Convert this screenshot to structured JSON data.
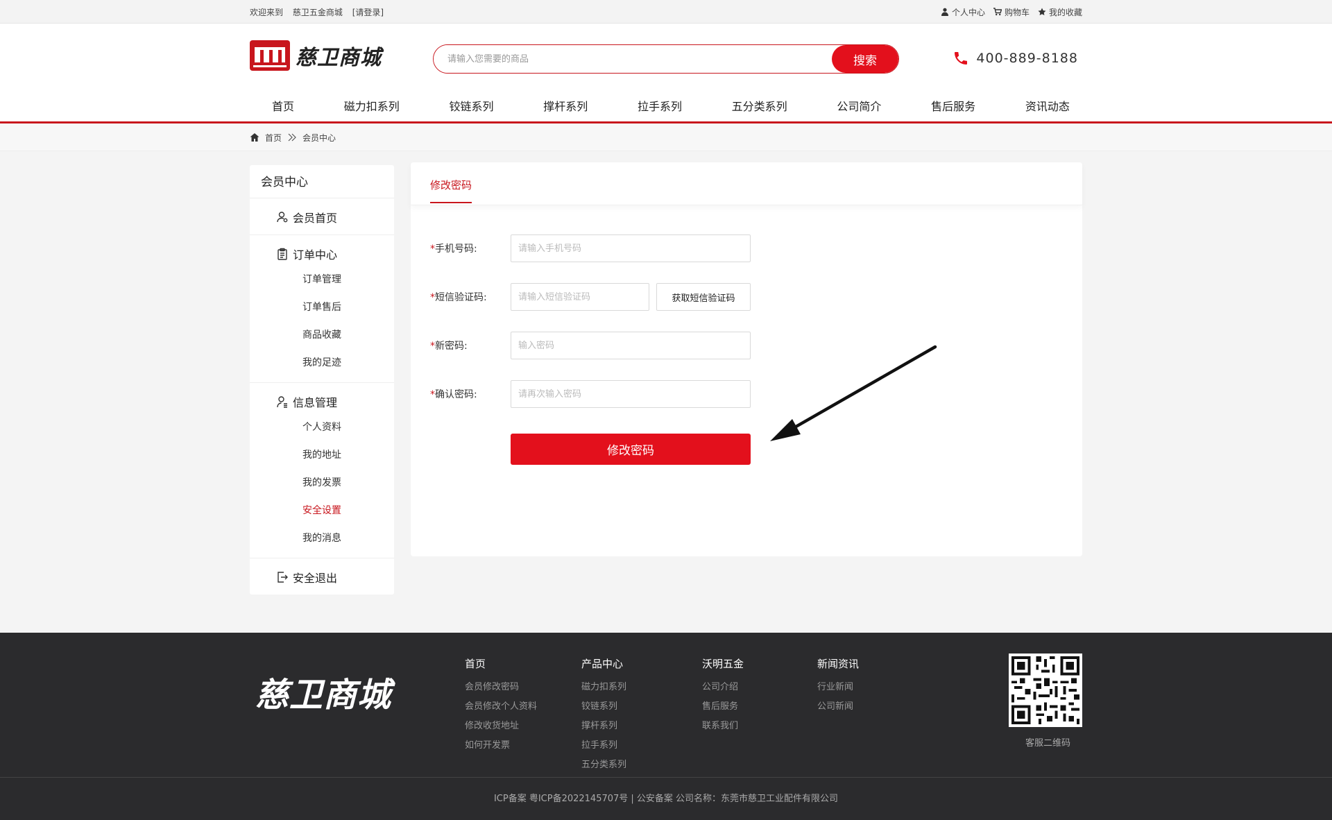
{
  "topbar": {
    "welcome": "欢迎来到",
    "site_name": "慈卫五金商城",
    "login": "[请登录]",
    "links": [
      {
        "icon": "user-icon",
        "label": "个人中心"
      },
      {
        "icon": "cart-icon",
        "label": "购物车"
      },
      {
        "icon": "star-icon",
        "label": "我的收藏"
      }
    ]
  },
  "header": {
    "logo_text": "慈卫商城",
    "search_placeholder": "请输入您需要的商品",
    "search_button": "搜索",
    "phone": "400-889-8188",
    "nav": [
      "首页",
      "磁力扣系列",
      "铰链系列",
      "撑杆系列",
      "拉手系列",
      "五分类系列",
      "公司简介",
      "售后服务",
      "资讯动态"
    ]
  },
  "breadcrumb": {
    "home": "首页",
    "current": "会员中心"
  },
  "sidebar": {
    "title": "会员中心",
    "groups": [
      {
        "icon": "member-icon",
        "label": "会员首页",
        "items": []
      },
      {
        "icon": "clipboard-icon",
        "label": "订单中心",
        "items": [
          "订单管理",
          "订单售后",
          "商品收藏",
          "我的足迹"
        ]
      },
      {
        "icon": "user-info-icon",
        "label": "信息管理",
        "items": [
          "个人资料",
          "我的地址",
          "我的发票",
          "安全设置",
          "我的消息"
        ]
      },
      {
        "icon": "logout-icon",
        "label": "安全退出",
        "items": []
      }
    ],
    "active_item": "安全设置"
  },
  "panel": {
    "tab": "修改密码",
    "fields": [
      {
        "label": "手机号码:",
        "placeholder": "请输入手机号码"
      },
      {
        "label": "短信验证码:",
        "placeholder": "请输入短信验证码"
      },
      {
        "label": "新密码:",
        "placeholder": "输入密码"
      },
      {
        "label": "确认密码:",
        "placeholder": "请再次输入密码"
      }
    ],
    "sms_button": "获取短信验证码",
    "submit": "修改密码"
  },
  "footer": {
    "logo_text": "慈卫商城",
    "columns": [
      {
        "title": "首页",
        "links": [
          "会员修改密码",
          "会员修改个人资料",
          "修改收货地址",
          "如何开发票"
        ]
      },
      {
        "title": "产品中心",
        "links": [
          "磁力扣系列",
          "铰链系列",
          "撑杆系列",
          "拉手系列",
          "五分类系列"
        ]
      },
      {
        "title": "沃明五金",
        "links": [
          "公司介绍",
          "售后服务",
          "联系我们"
        ]
      },
      {
        "title": "新闻资讯",
        "links": [
          "行业新闻",
          "公司新闻"
        ]
      }
    ],
    "qr_label": "客服二维码",
    "copyright": "ICP备案 粤ICP备2022145707号 | 公安备案 公司名称：东莞市慈卫工业配件有限公司"
  },
  "colors": {
    "brand_red": "#c8161d",
    "button_red": "#e3101c",
    "footer_bg": "#2b2b2d"
  }
}
